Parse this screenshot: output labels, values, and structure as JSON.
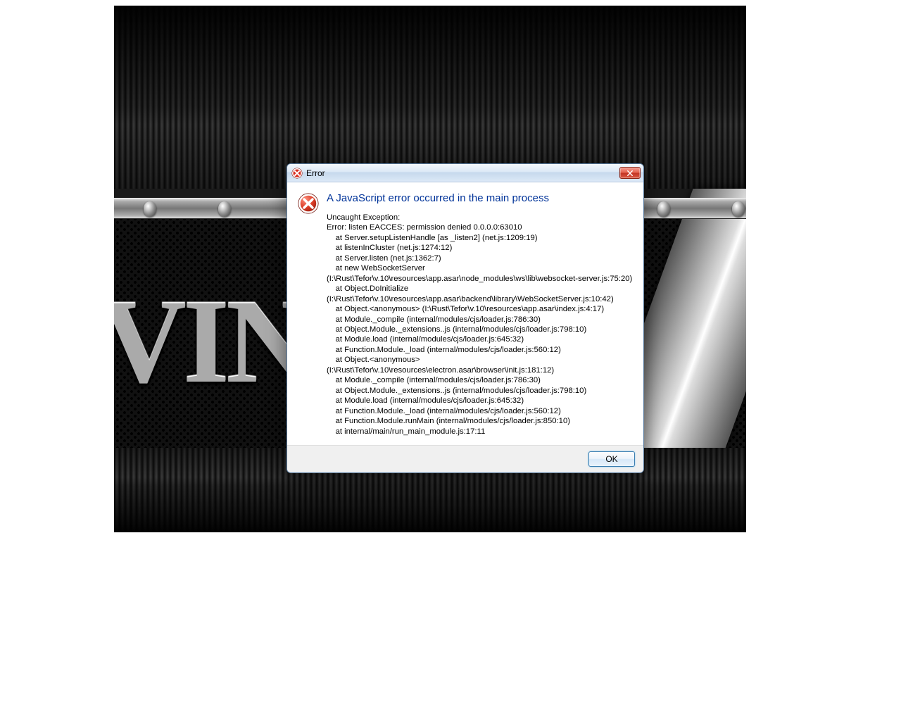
{
  "dialog": {
    "title": "Error",
    "heading": "A JavaScript error occurred in the main process",
    "ok_label": "OK",
    "error_text": "Uncaught Exception:\nError: listen EACCES: permission denied 0.0.0.0:63010\n    at Server.setupListenHandle [as _listen2] (net.js:1209:19)\n    at listenInCluster (net.js:1274:12)\n    at Server.listen (net.js:1362:7)\n    at new WebSocketServer\n(I:\\Rust\\Tefor\\v.10\\resources\\app.asar\\node_modules\\ws\\lib\\websocket-server.js:75:20)\n    at Object.DoInitialize\n(I:\\Rust\\Tefor\\v.10\\resources\\app.asar\\backend\\library\\WebSocketServer.js:10:42)\n    at Object.<anonymous> (I:\\Rust\\Tefor\\v.10\\resources\\app.asar\\index.js:4:17)\n    at Module._compile (internal/modules/cjs/loader.js:786:30)\n    at Object.Module._extensions..js (internal/modules/cjs/loader.js:798:10)\n    at Module.load (internal/modules/cjs/loader.js:645:32)\n    at Function.Module._load (internal/modules/cjs/loader.js:560:12)\n    at Object.<anonymous> (I:\\Rust\\Tefor\\v.10\\resources\\electron.asar\\browser\\init.js:181:12)\n    at Module._compile (internal/modules/cjs/loader.js:786:30)\n    at Object.Module._extensions..js (internal/modules/cjs/loader.js:798:10)\n    at Module.load (internal/modules/cjs/loader.js:645:32)\n    at Function.Module._load (internal/modules/cjs/loader.js:560:12)\n    at Function.Module.runMain (internal/modules/cjs/loader.js:850:10)\n    at internal/main/run_main_module.js:17:11"
  },
  "background": {
    "text_fragment": "VIN"
  }
}
